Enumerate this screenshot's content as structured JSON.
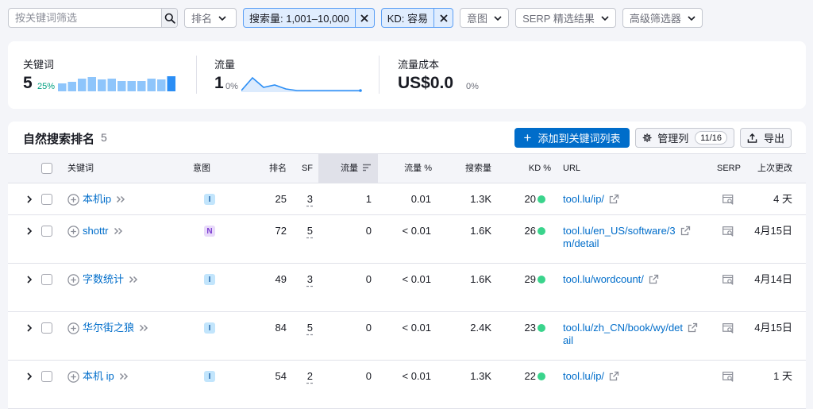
{
  "filters": {
    "search_placeholder": "按关键词筛选",
    "position_label": "排名",
    "volume_chip": "搜索量: 1,001–10,000",
    "kd_chip": "KD: 容易",
    "intent_label": "意图",
    "serp_label": "SERP 精选结果",
    "advanced_label": "高级筛选器"
  },
  "summary": {
    "keywords": {
      "label": "关键词",
      "value": "5",
      "change": "25%",
      "sparkline_bars": [
        0.55,
        0.62,
        0.82,
        0.95,
        0.78,
        0.85,
        0.7,
        0.7,
        0.7,
        0.85,
        0.78,
        1.0
      ]
    },
    "traffic": {
      "label": "流量",
      "value": "1",
      "change": "0%"
    },
    "traffic_cost": {
      "label": "流量成本",
      "value": "US$0.0",
      "change": "0%"
    }
  },
  "table": {
    "title": "自然搜索排名",
    "count": "5",
    "add_button": "添加到关键词列表",
    "manage_button": "管理列",
    "manage_badge": "11/16",
    "export_button": "导出",
    "headers": {
      "keyword": "关键词",
      "intent": "意图",
      "position": "排名",
      "sf": "SF",
      "traffic": "流量",
      "traffic_pct": "流量 %",
      "volume": "搜索量",
      "kd": "KD %",
      "url": "URL",
      "serp": "SERP",
      "updated": "上次更改"
    },
    "rows": [
      {
        "keyword": "本机ip",
        "intent": "I",
        "position": "25",
        "sf": "3",
        "traffic": "1",
        "traffic_pct": "0.01",
        "volume": "1.3K",
        "kd": "20",
        "url": "tool.lu/ip/",
        "updated": "4 天"
      },
      {
        "keyword": "shottr",
        "intent": "N",
        "position": "72",
        "sf": "5",
        "traffic": "0",
        "traffic_pct": "< 0.01",
        "volume": "1.6K",
        "kd": "26",
        "url": "tool.lu/en_US/software/3m/detail",
        "updated": "4月15日"
      },
      {
        "keyword": "字数统计",
        "intent": "I",
        "position": "49",
        "sf": "3",
        "traffic": "0",
        "traffic_pct": "< 0.01",
        "volume": "1.6K",
        "kd": "29",
        "url": "tool.lu/wordcount/",
        "updated": "4月14日"
      },
      {
        "keyword": "华尔街之狼",
        "intent": "I",
        "position": "84",
        "sf": "5",
        "traffic": "0",
        "traffic_pct": "< 0.01",
        "volume": "2.4K",
        "kd": "23",
        "url": "tool.lu/zh_CN/book/wy/detail",
        "updated": "4月15日"
      },
      {
        "keyword": "本机 ip",
        "intent": "I",
        "position": "54",
        "sf": "2",
        "traffic": "0",
        "traffic_pct": "< 0.01",
        "volume": "1.3K",
        "kd": "22",
        "url": "tool.lu/ip/",
        "updated": "1 天"
      }
    ]
  },
  "colors": {
    "accent": "#006dca",
    "kd_easy": "#3ad48c",
    "sparkline": "#8ec5fb"
  },
  "icons": [
    "search-icon",
    "chevron-down-icon",
    "close-icon",
    "plus-icon",
    "gear-icon",
    "upload-icon",
    "sort-icon",
    "expand-icon",
    "add-circle-icon",
    "double-chevron-icon",
    "external-link-icon",
    "serp-snapshot-icon"
  ]
}
